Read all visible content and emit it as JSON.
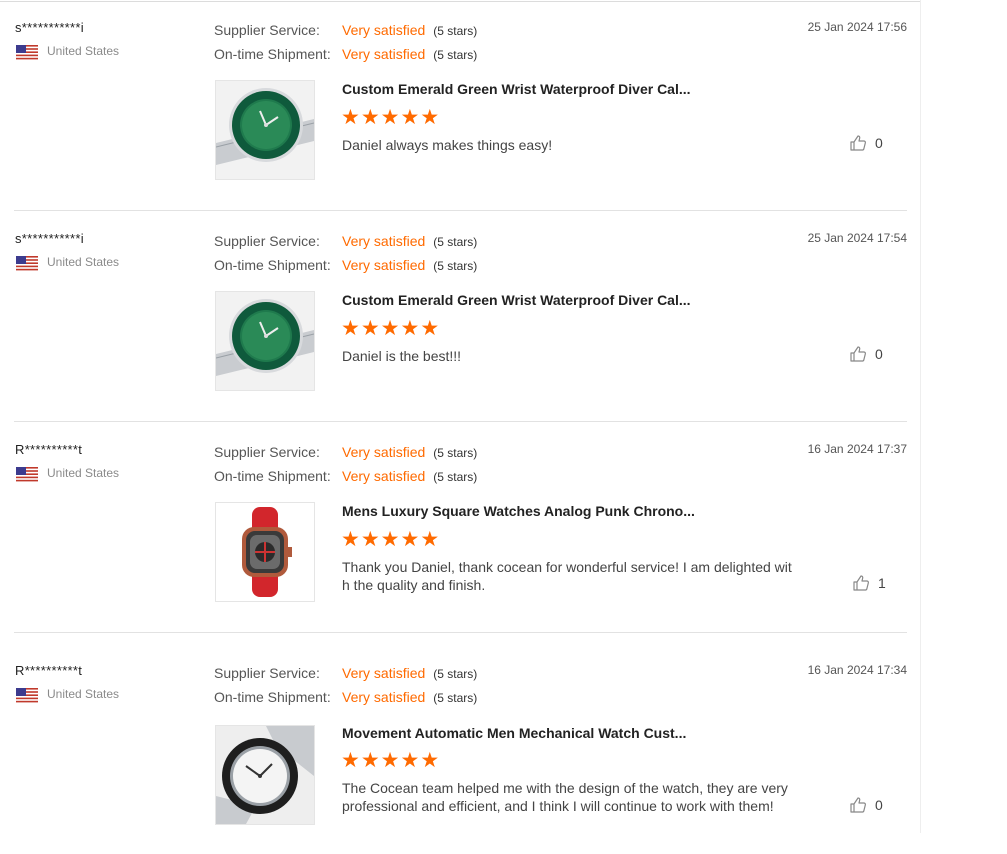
{
  "labels": {
    "supplier_service": "Supplier Service:",
    "ontime_shipment": "On-time Shipment:"
  },
  "colors": {
    "accent": "#ff6a00",
    "divider": "#e2e2e2"
  },
  "reviews": [
    {
      "user": "s***********i",
      "country": "United States",
      "supplier_service": "Very satisfied",
      "supplier_stars": "(5 stars)",
      "shipment": "Very satisfied",
      "shipment_stars": "(5 stars)",
      "date": "25 Jan 2024 17:56",
      "product_title": "Custom Emerald Green Wrist Waterproof Diver Cal...",
      "rating": 5,
      "comment": "Daniel always makes things easy!",
      "likes": "0",
      "image": "green-diver-watch"
    },
    {
      "user": "s***********i",
      "country": "United States",
      "supplier_service": "Very satisfied",
      "supplier_stars": "(5 stars)",
      "shipment": "Very satisfied",
      "shipment_stars": "(5 stars)",
      "date": "25 Jan 2024 17:54",
      "product_title": "Custom Emerald Green Wrist Waterproof Diver Cal...",
      "rating": 5,
      "comment": "Daniel is the best!!!",
      "likes": "0",
      "image": "green-diver-watch"
    },
    {
      "user": "R**********t",
      "country": "United States",
      "supplier_service": "Very satisfied",
      "supplier_stars": "(5 stars)",
      "shipment": "Very satisfied",
      "shipment_stars": "(5 stars)",
      "date": "16 Jan 2024 17:37",
      "product_title": "Mens Luxury Square Watches Analog Punk Chrono...",
      "rating": 5,
      "comment": "Thank you Daniel, thank cocean for wonderful service! I am delighted with the quality and finish.",
      "likes": "1",
      "image": "red-square-watch"
    },
    {
      "user": "R**********t",
      "country": "United States",
      "supplier_service": "Very satisfied",
      "supplier_stars": "(5 stars)",
      "shipment": "Very satisfied",
      "shipment_stars": "(5 stars)",
      "date": "16 Jan 2024 17:34",
      "product_title": "Movement Automatic Men Mechanical Watch Cust...",
      "rating": 5,
      "comment": "The Cocean team helped me with the design of the watch, they are very professional and efficient, and I think I will continue to work with them!",
      "likes": "0",
      "image": "white-diver-watch"
    }
  ]
}
